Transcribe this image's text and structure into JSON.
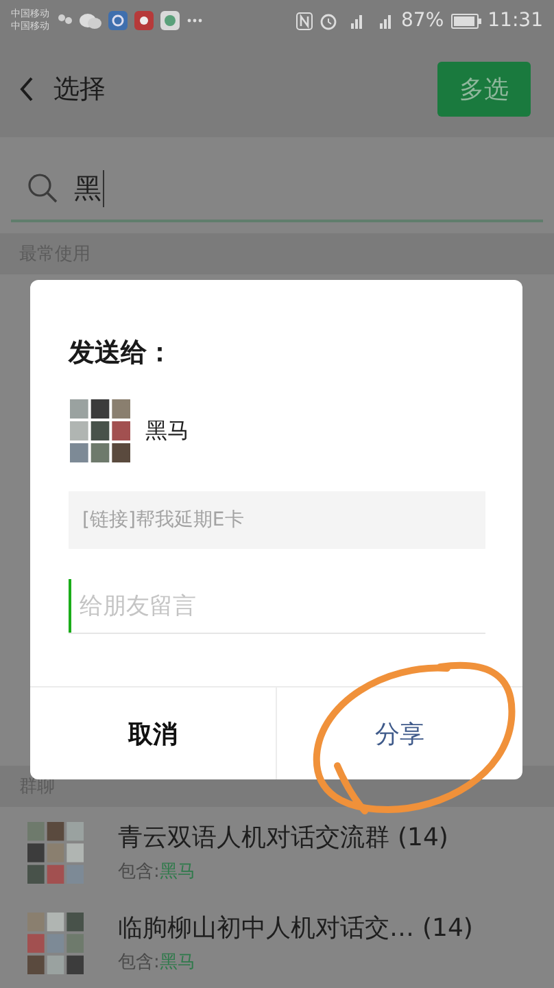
{
  "status_bar": {
    "carriers": [
      "中国移动",
      "中国移动"
    ],
    "battery": "87%",
    "time": "11:31"
  },
  "header": {
    "title": "选择",
    "action": "多选"
  },
  "search": {
    "value": "黑"
  },
  "sections": [
    {
      "title": "最常使用"
    },
    {
      "title": "群聊",
      "items": [
        {
          "name": "青云双语人机对话交流群",
          "count": "(14)",
          "match_label": "包含:",
          "match": "黑马"
        },
        {
          "name": "临朐柳山初中人机对话交…",
          "count": "(14)",
          "match_label": "包含:",
          "match": "黑马"
        }
      ]
    }
  ],
  "dialog": {
    "title": "发送给：",
    "recipient": "黑马",
    "link_preview": "[链接]帮我延期E卡",
    "message": {
      "placeholder": "给朋友留言"
    },
    "buttons": [
      {
        "label": "取消",
        "kind": "cancel"
      },
      {
        "label": "分享",
        "kind": "primary"
      }
    ]
  }
}
